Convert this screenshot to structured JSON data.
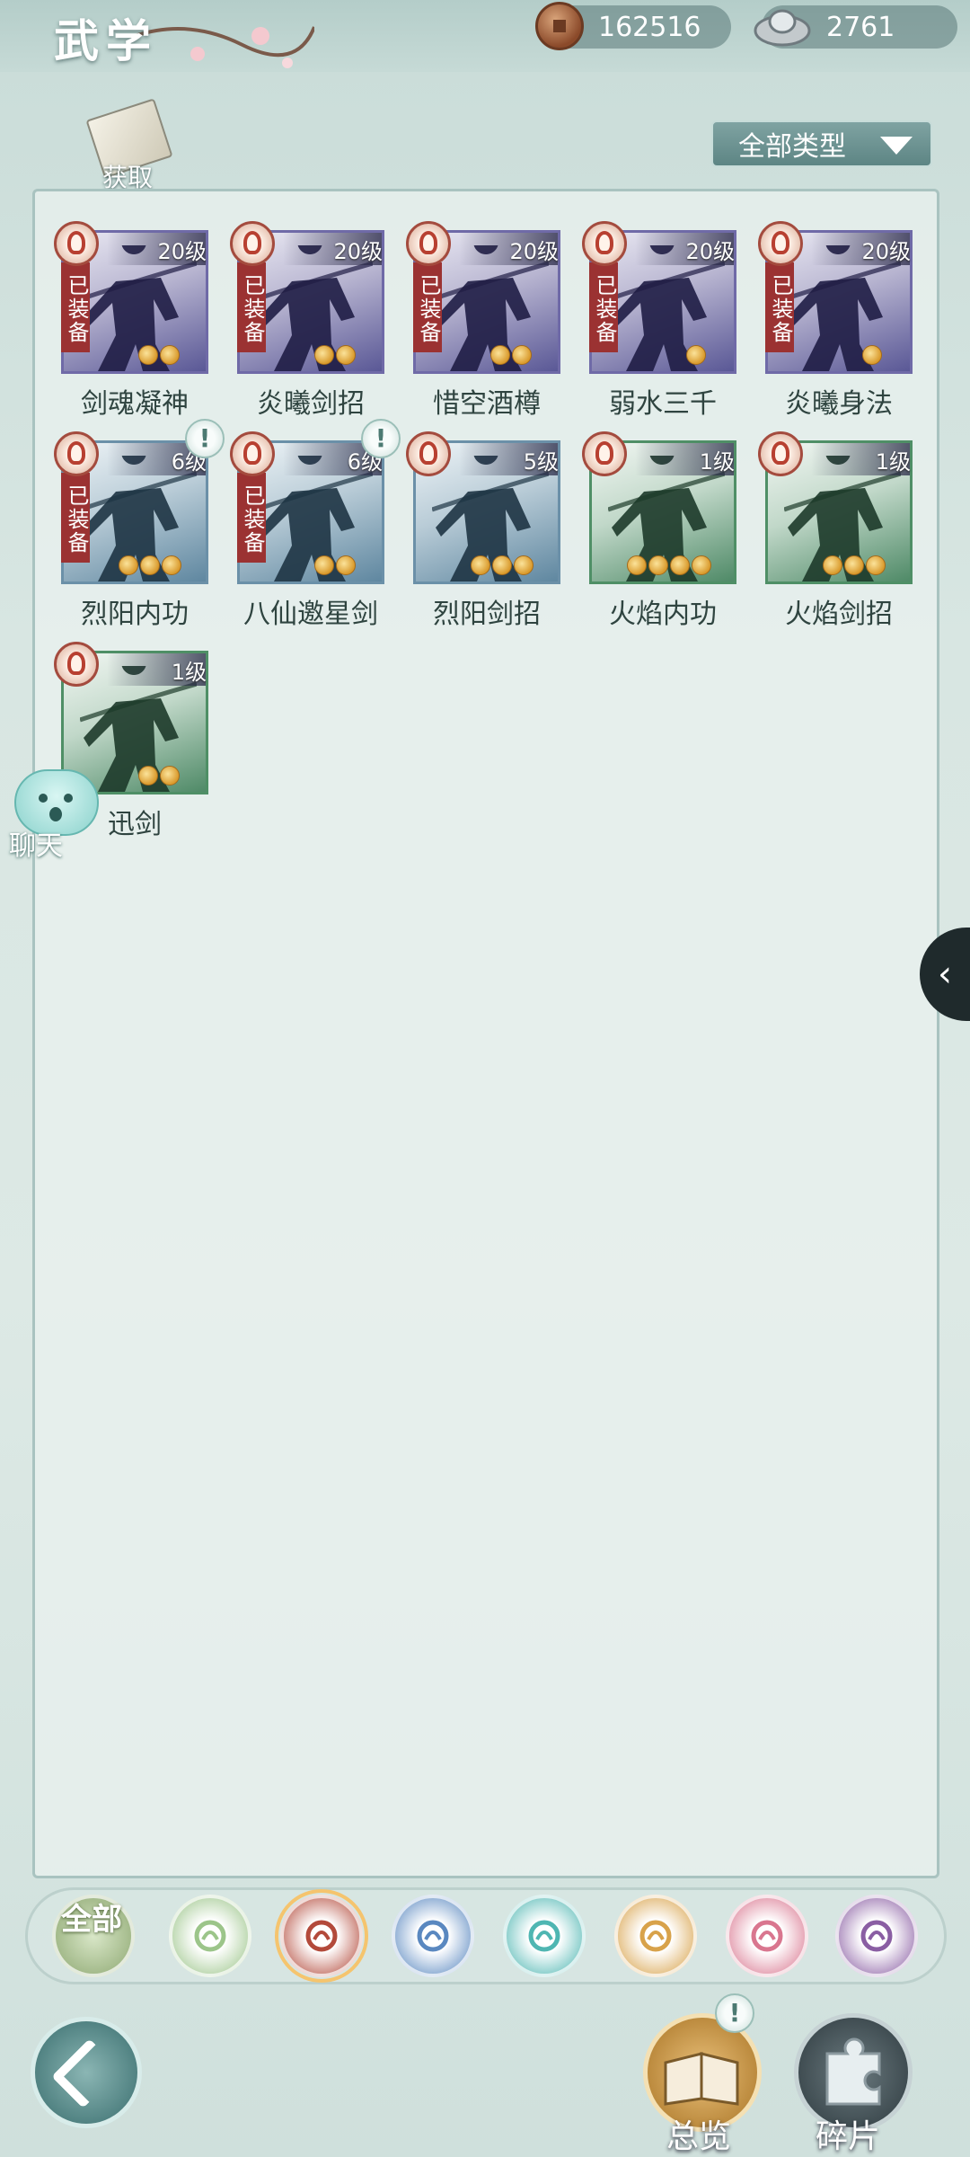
{
  "header": {
    "title": "武学",
    "currencies": [
      {
        "name": "copper-coin",
        "value": "162516"
      },
      {
        "name": "silver-ingot",
        "value": "2761"
      }
    ]
  },
  "toolbar": {
    "acquire_label": "获取",
    "filter_label": "全部类型"
  },
  "skills": [
    {
      "name": "剑魂凝神",
      "level": "20级",
      "equipped": "已装备",
      "stars": 2,
      "rarity": "purple",
      "alert": false
    },
    {
      "name": "炎曦剑招",
      "level": "20级",
      "equipped": "已装备",
      "stars": 2,
      "rarity": "purple",
      "alert": false
    },
    {
      "name": "惜空酒樽",
      "level": "20级",
      "equipped": "已装备",
      "stars": 2,
      "rarity": "purple",
      "alert": false
    },
    {
      "name": "弱水三千",
      "level": "20级",
      "equipped": "已装备",
      "stars": 1,
      "rarity": "purple",
      "alert": false
    },
    {
      "name": "炎曦身法",
      "level": "20级",
      "equipped": "已装备",
      "stars": 1,
      "rarity": "purple",
      "alert": false
    },
    {
      "name": "烈阳内功",
      "level": "6级",
      "equipped": "已装备",
      "stars": 3,
      "rarity": "blue",
      "alert": true
    },
    {
      "name": "八仙邀星剑",
      "level": "6级",
      "equipped": "已装备",
      "stars": 2,
      "rarity": "blue",
      "alert": true
    },
    {
      "name": "烈阳剑招",
      "level": "5级",
      "equipped": "",
      "stars": 3,
      "rarity": "blue",
      "alert": false
    },
    {
      "name": "火焰内功",
      "level": "1级",
      "equipped": "",
      "stars": 4,
      "rarity": "green",
      "alert": false
    },
    {
      "name": "火焰剑招",
      "level": "1级",
      "equipped": "",
      "stars": 3,
      "rarity": "green",
      "alert": false
    },
    {
      "name": "迅剑",
      "level": "1级",
      "equipped": "",
      "stars": 2,
      "rarity": "green",
      "alert": false
    }
  ],
  "chat": {
    "label": "聊天"
  },
  "categories": [
    {
      "name": "all",
      "label": "全部",
      "color": "#9bb37f"
    },
    {
      "name": "green-sword",
      "color": "#9cc58a"
    },
    {
      "name": "flame",
      "color": "#b34a3b",
      "selected": true
    },
    {
      "name": "wave",
      "color": "#5a88c0"
    },
    {
      "name": "butterfly",
      "color": "#4fb6b2"
    },
    {
      "name": "gold-seal",
      "color": "#d8a24a"
    },
    {
      "name": "moon",
      "color": "#d9768f"
    },
    {
      "name": "rose",
      "color": "#8a5ea3"
    }
  ],
  "bottom": {
    "overview_label": "总览",
    "fragments_label": "碎片"
  }
}
